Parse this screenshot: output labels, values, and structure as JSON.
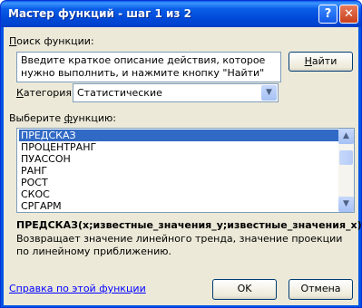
{
  "window": {
    "title": "Мастер функций - шаг 1 из 2",
    "help_icon": "?",
    "close_icon": "✕"
  },
  "search": {
    "label_pre": "",
    "label_ul": "П",
    "label_post": "оиск функции:",
    "description": "Введите краткое описание действия, которое нужно выполнить, и нажмите кнопку \"Найти\"",
    "find_button_ul": "Н",
    "find_button_post": "айти"
  },
  "category": {
    "label_ul": "К",
    "label_post": "атегория:",
    "value": "Статистические"
  },
  "functions": {
    "label_pre": "Выберите ",
    "label_ul": "ф",
    "label_post": "ункцию:",
    "items": [
      "ПРЕДСКАЗ",
      "ПРОЦЕНТРАНГ",
      "ПУАССОН",
      "РАНГ",
      "РОСТ",
      "СКОС",
      "СРГАРМ"
    ],
    "selected_index": 0,
    "scroll_position_fraction": 0.15
  },
  "details": {
    "signature": "ПРЕДСКАЗ(x;известные_значения_y;известные_значения_x)",
    "explanation": "Возвращает значение линейного тренда, значение проекции по линейному приближению."
  },
  "footer": {
    "help_link": "Справка по этой функции",
    "ok_label": "OK",
    "cancel_label": "Отмена"
  }
}
